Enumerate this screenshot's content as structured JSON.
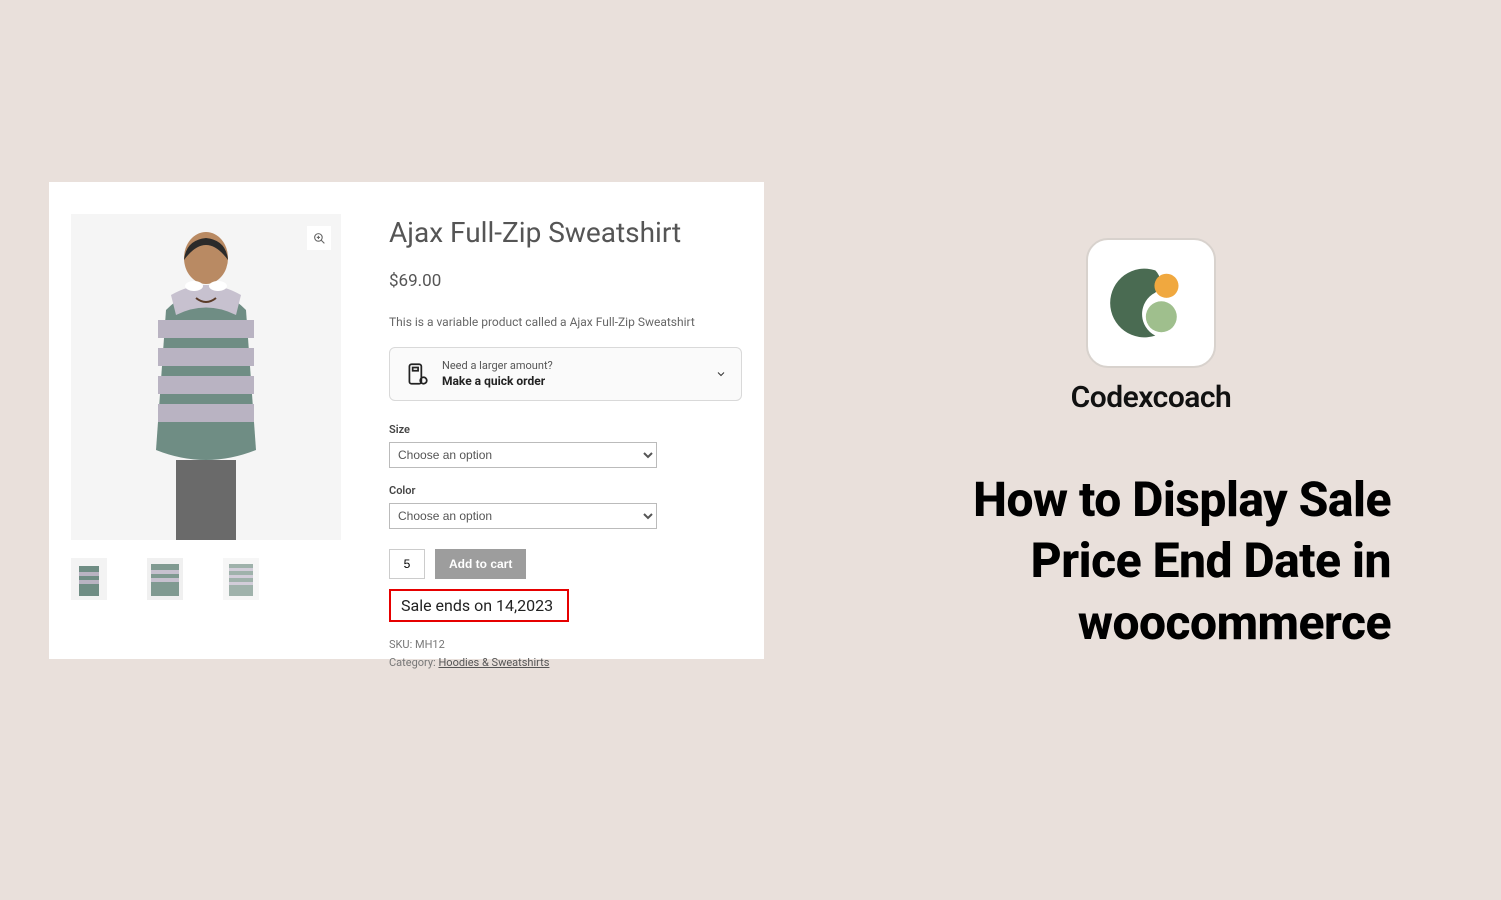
{
  "product": {
    "title": "Ajax Full-Zip Sweatshirt",
    "price": "$69.00",
    "description": "This is a variable product called a Ajax Full-Zip Sweatshirt",
    "quick_order_prompt": "Need a larger amount?",
    "quick_order_action": "Make a quick order",
    "size_label": "Size",
    "size_option": "Choose an option",
    "color_label": "Color",
    "color_option": "Choose an option",
    "quantity": "5",
    "add_to_cart": "Add to cart",
    "sale_notice": "Sale ends on 14,2023",
    "sku_label": "SKU: ",
    "sku_value": "MH12",
    "category_label": "Category: ",
    "category_value": "Hoodies & Sweatshirts"
  },
  "brand": {
    "name": "Codexcoach"
  },
  "hero": {
    "title_line1": "How to Display Sale",
    "title_line2": "Price End Date in",
    "title_line3": "woocommerce"
  }
}
